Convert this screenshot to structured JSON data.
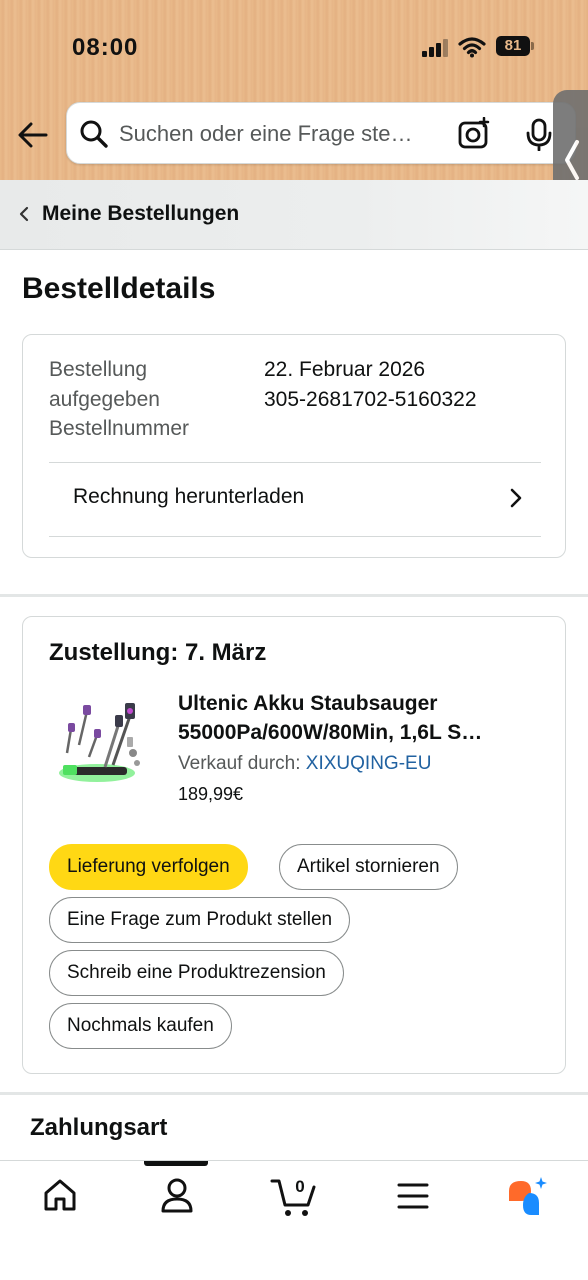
{
  "status_bar": {
    "time": "08:00",
    "battery": "81"
  },
  "search": {
    "placeholder": "Suchen oder eine Frage ste…"
  },
  "breadcrumb": {
    "label": "Meine Bestellungen"
  },
  "page": {
    "title": "Bestelldetails"
  },
  "order": {
    "placed_label": "Bestellung aufgegeben",
    "placed_value": "22. Februar 2026",
    "number_label": "Bestellnummer",
    "number_value": "305-2681702-5160322",
    "invoice_label": "Rechnung herunterladen"
  },
  "delivery": {
    "title": "Zustellung: 7. März",
    "product_title_line1": "Ultenic Akku Staubsauger",
    "product_title_line2": "55000Pa/600W/80Min, 1,6L S…",
    "seller_prefix": "Verkauf durch: ",
    "seller_name": "XIXUQING-EU",
    "price": "189,99€",
    "actions": {
      "track": "Lieferung verfolgen",
      "cancel": "Artikel stornieren",
      "question": "Eine Frage zum Produkt stellen",
      "review": "Schreib eine Produktrezension",
      "buy_again": "Nochmals kaufen"
    }
  },
  "payment": {
    "title": "Zahlungsart"
  },
  "bottom_nav": {
    "items": [
      "home-icon",
      "account-icon",
      "cart-icon",
      "menu-icon",
      "rufus-icon"
    ],
    "cart_count": "0",
    "active": "account"
  },
  "colors": {
    "primary_button": "#ffd814",
    "link": "#2162a1",
    "rufus_orange": "#ff6a2a",
    "rufus_blue": "#1a8cff"
  }
}
